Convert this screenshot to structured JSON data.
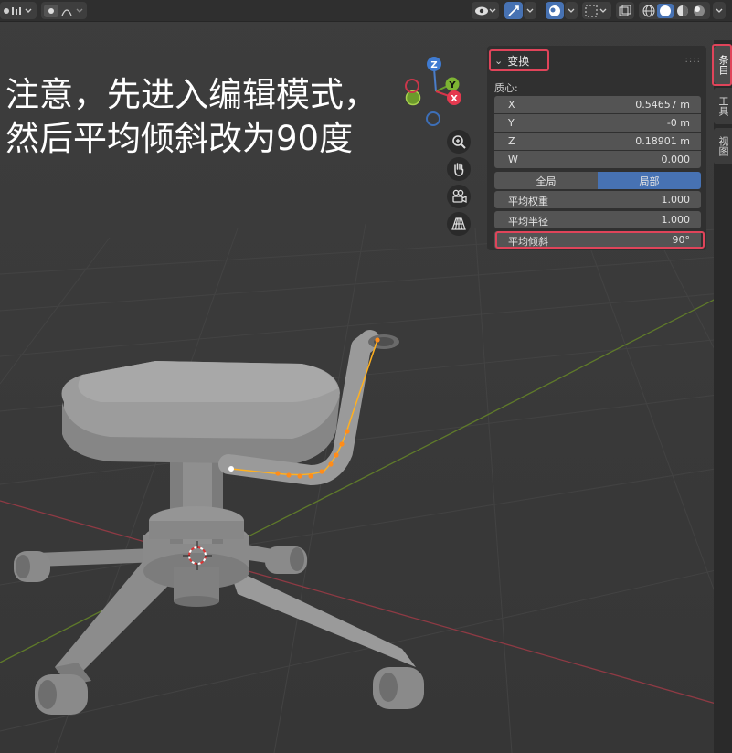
{
  "header": {
    "icons": [
      "view-layers-icon",
      "dropdown-chevron-icon",
      "overlay-dot-icon",
      "curve-icon",
      "visibility-icon",
      "gizmo-icon",
      "viewport-shading-icon",
      "snap-icon",
      "xray-icon",
      "wireframe-shading-icon",
      "solid-shading-icon",
      "material-shading-icon",
      "rendered-shading-icon"
    ]
  },
  "overlay_text": {
    "line1": "注意，先进入编辑模式，",
    "line2": "然后平均倾斜改为90度"
  },
  "gizmo": {
    "z": "Z",
    "y": "Y",
    "x": "X"
  },
  "panel": {
    "title": "变换",
    "centroid_label": "质心:",
    "fields": [
      {
        "label": "X",
        "value": "0.54657 m"
      },
      {
        "label": "Y",
        "value": "-0 m"
      },
      {
        "label": "Z",
        "value": "0.18901 m"
      },
      {
        "label": "W",
        "value": "0.000"
      }
    ],
    "space_global": "全局",
    "space_local": "局部",
    "mean_weight_label": "平均权重",
    "mean_weight_value": "1.000",
    "mean_radius_label": "平均半径",
    "mean_radius_value": "1.000",
    "mean_tilt_label": "平均倾斜",
    "mean_tilt_value": "90°"
  },
  "tabs": {
    "item": "条目",
    "tool": "工具",
    "view": "视图"
  },
  "colors": {
    "highlight": "#e0445a",
    "accent_blue": "#4772b3",
    "curve_orange": "#ff8c1a",
    "axis_red": "#b0343f",
    "axis_green": "#6b8e23"
  }
}
